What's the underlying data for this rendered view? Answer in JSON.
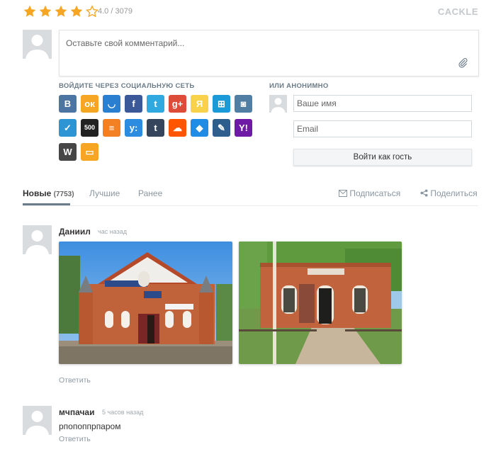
{
  "rating": {
    "text": "4.0 / 3079",
    "stars": 4,
    "max": 5,
    "star_color": "#f6a623"
  },
  "brand": "CACKLE",
  "comment_form": {
    "placeholder": "Оставьте свой комментарий..."
  },
  "social": {
    "label": "ВОЙДИТЕ ЧЕРЕЗ СОЦИАЛЬНУЮ СЕТЬ",
    "networks": [
      {
        "name": "vkontakte",
        "glyph": "B",
        "color": "#4c75a3"
      },
      {
        "name": "odnoklassniki",
        "glyph": "ок",
        "color": "#f5a623"
      },
      {
        "name": "mail-ru",
        "glyph": "◡",
        "color": "#2b7fd1"
      },
      {
        "name": "facebook",
        "glyph": "f",
        "color": "#3b5998"
      },
      {
        "name": "twitter",
        "glyph": "t",
        "color": "#2fa9e0"
      },
      {
        "name": "google-plus",
        "glyph": "g+",
        "color": "#dd4b39"
      },
      {
        "name": "yandex",
        "glyph": "Я",
        "color": "#f8d24a"
      },
      {
        "name": "windows",
        "glyph": "⊞",
        "color": "#1a9bd7"
      },
      {
        "name": "instagram",
        "glyph": "◙",
        "color": "#517fa4"
      },
      {
        "name": "myworld",
        "glyph": "✓",
        "color": "#2d95d4"
      },
      {
        "name": "500px",
        "glyph": "500",
        "color": "#222222"
      },
      {
        "name": "stackoverflow",
        "glyph": "≡",
        "color": "#f48024"
      },
      {
        "name": "yahoo-answers",
        "glyph": "y:",
        "color": "#2c8ce0"
      },
      {
        "name": "tumblr",
        "glyph": "t",
        "color": "#35465c"
      },
      {
        "name": "soundcloud",
        "glyph": "☁",
        "color": "#ff5500"
      },
      {
        "name": "dropbox",
        "glyph": "◆",
        "color": "#1f8ce6"
      },
      {
        "name": "livejournal",
        "glyph": "✎",
        "color": "#2e5e8c"
      },
      {
        "name": "yahoo",
        "glyph": "Y!",
        "color": "#6e1aa6"
      },
      {
        "name": "wordpress",
        "glyph": "W",
        "color": "#464646"
      },
      {
        "name": "comment",
        "glyph": "▭",
        "color": "#f6a623"
      }
    ]
  },
  "anonymous": {
    "label": "ИЛИ АНОНИМНО",
    "name_placeholder": "Ваше имя",
    "email_placeholder": "Email",
    "guest_button": "Войти как гость"
  },
  "tabs": {
    "new_label": "Новые",
    "new_count": "(7753)",
    "best_label": "Лучшие",
    "earlier_label": "Ранее",
    "subscribe_label": "Подписаться",
    "share_label": "Поделиться"
  },
  "comments": [
    {
      "author": "Даниил",
      "time": "час назад",
      "text": "",
      "reply": "Ответить"
    },
    {
      "author": "мчпачаи",
      "time": "5 часов назад",
      "text": "рпопоппрпаром",
      "reply": "Ответить"
    }
  ]
}
